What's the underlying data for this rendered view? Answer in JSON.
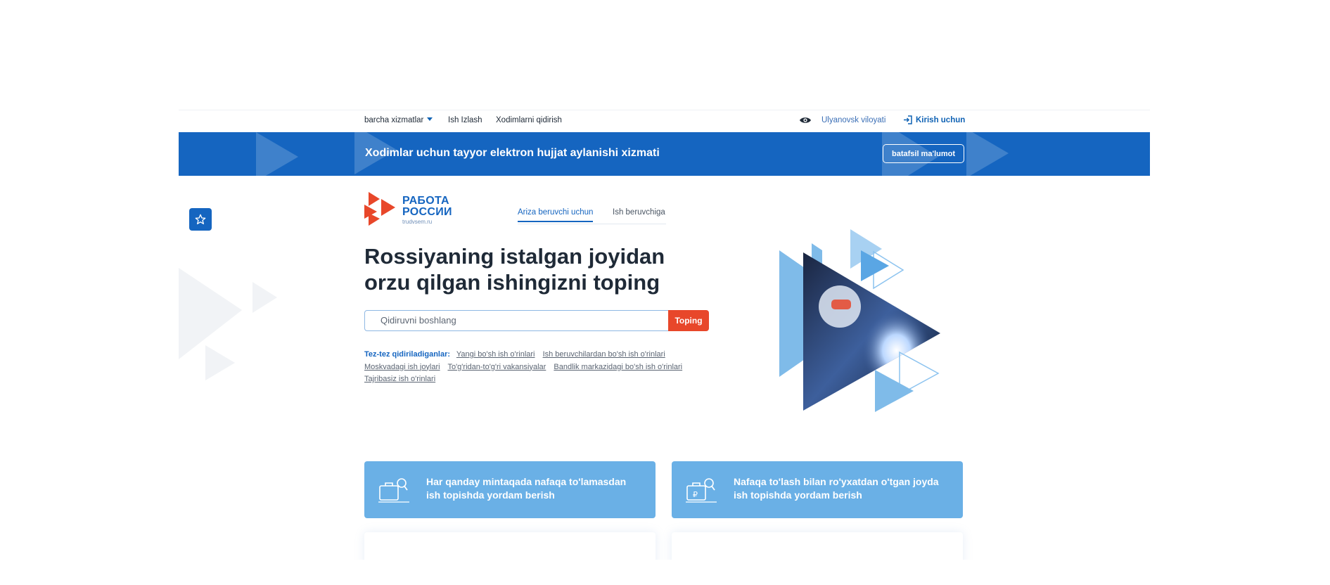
{
  "topbar": {
    "all_services": "barcha xizmatlar",
    "job_search": "Ish Izlash",
    "employee_search": "Xodimlarni qidirish",
    "region": "Ulyanovsk viloyati",
    "login": "Kirish uchun"
  },
  "banner": {
    "text": "Xodimlar uchun tayyor elektron hujjat aylanishi xizmati",
    "button": "batafsil ma'lumot",
    "color": "#1565c0"
  },
  "logo": {
    "line1": "РАБОТА",
    "line2": "РОССИИ",
    "site": "trudvsem.ru"
  },
  "tabs": [
    {
      "label": "Ariza beruvchi uchun",
      "active": true
    },
    {
      "label": "Ish beruvchiga",
      "active": false
    }
  ],
  "hero": {
    "line1": "Rossiyaning istalgan joyidan",
    "line2": "orzu qilgan ishingizni toping"
  },
  "search": {
    "placeholder": "Qidiruvni boshlang",
    "button": "Toping"
  },
  "frequent": {
    "label": "Tez-tez qidiriladiganlar:",
    "links": [
      "Yangi bo'sh ish o'rinlari",
      "Ish beruvchilardan bo'sh ish o'rinlari",
      "Moskvadagi ish joylari",
      "To'g'ridan-to'g'ri vakansiyalar",
      "Bandlik markazidagi bo'sh ish o'rinlari",
      "Tajribasiz ish o'rinlari"
    ]
  },
  "cards": [
    {
      "text": "Har qanday mintaqada nafaqa to'lamasdan ish topishda yordam berish",
      "icon": "briefcase-search-icon"
    },
    {
      "text": "Nafaqa to'lash bilan ro'yxatdan o'tgan joyda ish topishda yordam berish",
      "icon": "briefcase-ruble-search-icon"
    }
  ],
  "colors": {
    "accent": "#1565c0",
    "action": "#e8472a",
    "card": "#6ab0e6"
  }
}
